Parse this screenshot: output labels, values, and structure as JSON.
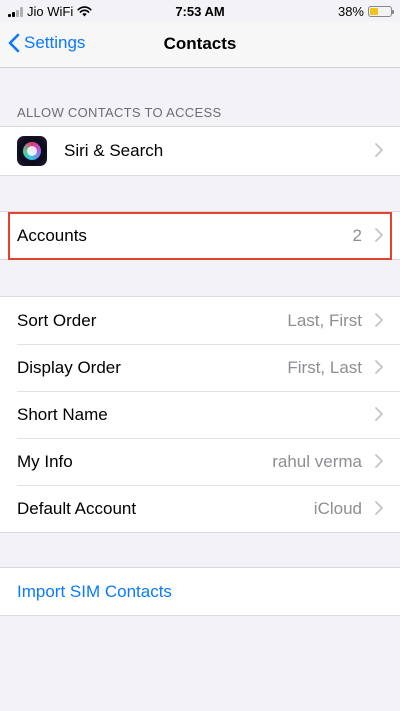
{
  "status_bar": {
    "carrier": "Jio WiFi",
    "time": "7:53 AM",
    "battery": "38%",
    "battery_level": 0.38
  },
  "nav": {
    "back_label": "Settings",
    "title": "Contacts"
  },
  "allow_section": {
    "header": "ALLOW CONTACTS TO ACCESS",
    "siri_label": "Siri & Search"
  },
  "accounts": {
    "label": "Accounts",
    "value": "2"
  },
  "settings_rows": [
    {
      "label": "Sort Order",
      "value": "Last, First"
    },
    {
      "label": "Display Order",
      "value": "First, Last"
    },
    {
      "label": "Short Name",
      "value": ""
    },
    {
      "label": "My Info",
      "value": "rahul verma"
    },
    {
      "label": "Default Account",
      "value": "iCloud"
    }
  ],
  "import_sim": {
    "label": "Import SIM Contacts"
  },
  "colors": {
    "accent": "#0a7aff",
    "highlight": "#e8402a",
    "background": "#f2f2f7"
  }
}
